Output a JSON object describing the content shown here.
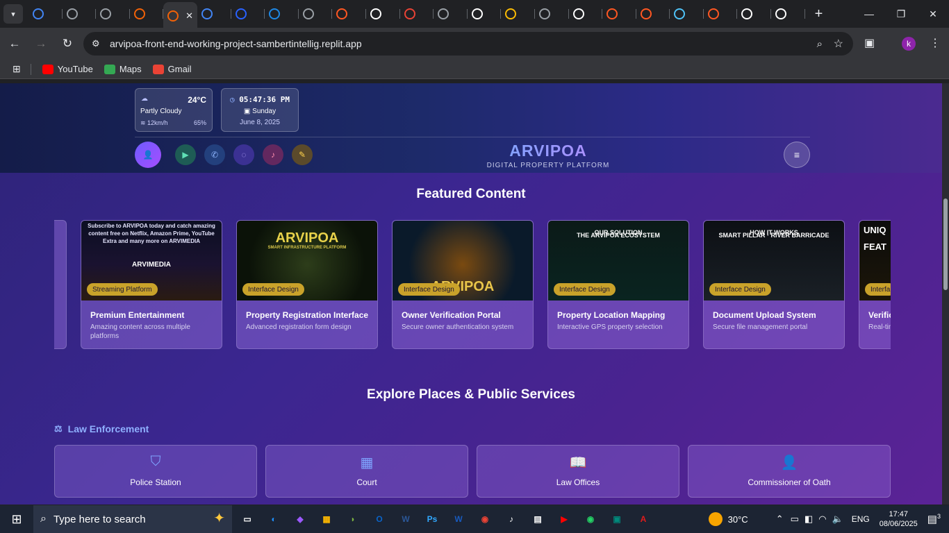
{
  "browser": {
    "active_tab_close": "✕",
    "new_tab": "+",
    "url": "arvipoa-front-end-working-project-sambertintellig.replit.app",
    "profile_initial": "k",
    "tabs": [
      {
        "icon": "chrome-icon",
        "color": "#4285f4"
      },
      {
        "icon": "openai-icon",
        "color": "#9aa0a6"
      },
      {
        "icon": "openai-icon",
        "color": "#9aa0a6"
      },
      {
        "icon": "replit-icon",
        "color": "#f26207"
      },
      {
        "icon": "replit-icon",
        "color": "#f26207"
      },
      {
        "icon": "google-icon",
        "color": "#4285f4"
      },
      {
        "icon": "cart-icon",
        "color": "#2962ff"
      },
      {
        "icon": "app-icon",
        "color": "#1e88e5"
      },
      {
        "icon": "openai-icon",
        "color": "#9aa0a6"
      },
      {
        "icon": "fire-icon",
        "color": "#ff5722"
      },
      {
        "icon": "app-icon",
        "color": "#ffffff"
      },
      {
        "icon": "gmail-icon",
        "color": "#ea4335"
      },
      {
        "icon": "settings-icon",
        "color": "#9aa0a6"
      },
      {
        "icon": "perplexity-icon",
        "color": "#ffffff"
      },
      {
        "icon": "drive-icon",
        "color": "#fbbc04"
      },
      {
        "icon": "openai-icon",
        "color": "#9aa0a6"
      },
      {
        "icon": "google-lens-icon",
        "color": "#ffffff"
      },
      {
        "icon": "app-icon",
        "color": "#ff5722"
      },
      {
        "icon": "app-icon",
        "color": "#ff5722"
      },
      {
        "icon": "app-icon",
        "color": "#4fc3f7"
      },
      {
        "icon": "app-icon",
        "color": "#ff5722"
      },
      {
        "icon": "copilot-icon",
        "color": "#ffffff"
      },
      {
        "icon": "github-icon",
        "color": "#ffffff"
      }
    ],
    "bookmarks": [
      {
        "label": "YouTube",
        "color": "#ff0000"
      },
      {
        "label": "Maps",
        "color": "#34a853"
      },
      {
        "label": "Gmail",
        "color": "#ea4335"
      }
    ]
  },
  "header": {
    "weather": {
      "temp": "24°C",
      "condition": "Partly Cloudy",
      "wind": "12km/h",
      "humidity": "65%"
    },
    "clock": {
      "time": "05:47:36 PM",
      "day": "Sunday",
      "date": "June 8, 2025"
    },
    "brand": {
      "name": "ARVIPOA",
      "tagline": "DIGITAL PROPERTY PLATFORM"
    }
  },
  "featured": {
    "title": "Featured Content",
    "cards": [
      {
        "badge": "Streaming Platform",
        "title": "Premium Entertainment",
        "desc": "Amazing content across multiple platforms",
        "img_caption": "Subscribe to ARVIPOA today and catch amazing content free on Netflix, Amazon Prime, YouTube Extra and many more on ARVIMEDIA",
        "img_brand": "ARVIMEDIA"
      },
      {
        "badge": "Interface Design",
        "title": "Property Registration Interface",
        "desc": "Advanced registration form design",
        "img_caption": "ARVIPOA",
        "img_brand": "SMART INFRASTRUCTURE PLATFORM"
      },
      {
        "badge": "Interface Design",
        "title": "Owner Verification Portal",
        "desc": "Secure owner authentication system",
        "img_caption": "ARVIPOA",
        "img_brand": ""
      },
      {
        "badge": "Interface Design",
        "title": "Property Location Mapping",
        "desc": "Interactive GPS property selection",
        "img_caption": "OUR SOLUTION",
        "img_brand": "THE ARVIPOA ECOSYSTEM"
      },
      {
        "badge": "Interface Design",
        "title": "Document Upload System",
        "desc": "Secure file management portal",
        "img_caption": "HOW IT WORKS",
        "img_brand": "SMART PILLAR · RIVER BARRICADE"
      },
      {
        "badge": "Interfa",
        "title": "Verific",
        "desc": "Real-tim",
        "img_caption": "UNIQ",
        "img_brand": "FEAT"
      }
    ]
  },
  "services": {
    "title": "Explore Places & Public Services",
    "category": "Law Enforcement",
    "items": [
      {
        "label": "Police Station",
        "icon": "shield-icon"
      },
      {
        "label": "Court",
        "icon": "building-icon"
      },
      {
        "label": "Law Offices",
        "icon": "book-icon"
      },
      {
        "label": "Commissioner of Oath",
        "icon": "user-check-icon"
      }
    ]
  },
  "taskbar": {
    "search_placeholder": "Type here to search",
    "weather": "30°C",
    "lang": "ENG",
    "time": "17:47",
    "date": "08/06/2025",
    "notifications": "3"
  }
}
